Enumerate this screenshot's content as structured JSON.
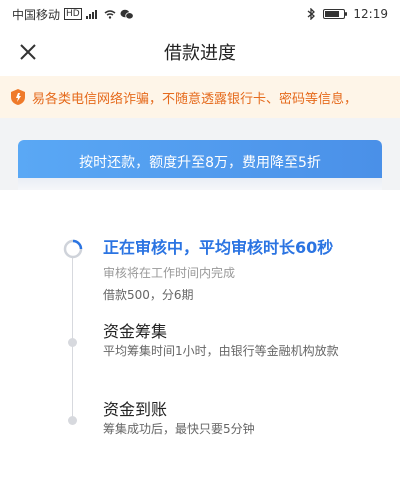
{
  "status_bar": {
    "carrier": "中国移动",
    "time": "12:19",
    "battery_level": 0.8
  },
  "header": {
    "title": "借款进度"
  },
  "notice": {
    "text": "易各类电信网络诈骗，不随意透露银行卡、密码等信息，"
  },
  "banner": {
    "text": "按时还款，额度升至8万，费用降至5折"
  },
  "steps": [
    {
      "title": "正在审核中，平均审核时长60秒",
      "desc": "审核将在工作时间内完成",
      "extra": "借款500，分6期"
    },
    {
      "title": "资金筹集",
      "desc": "平均筹集时间1小时，由银行等金融机构放款"
    },
    {
      "title": "资金到账",
      "desc": "筹集成功后，最快只要5分钟"
    }
  ],
  "colors": {
    "accent": "#2b74e2",
    "notice_text": "#e56a1c",
    "banner": "#4a90e8"
  }
}
